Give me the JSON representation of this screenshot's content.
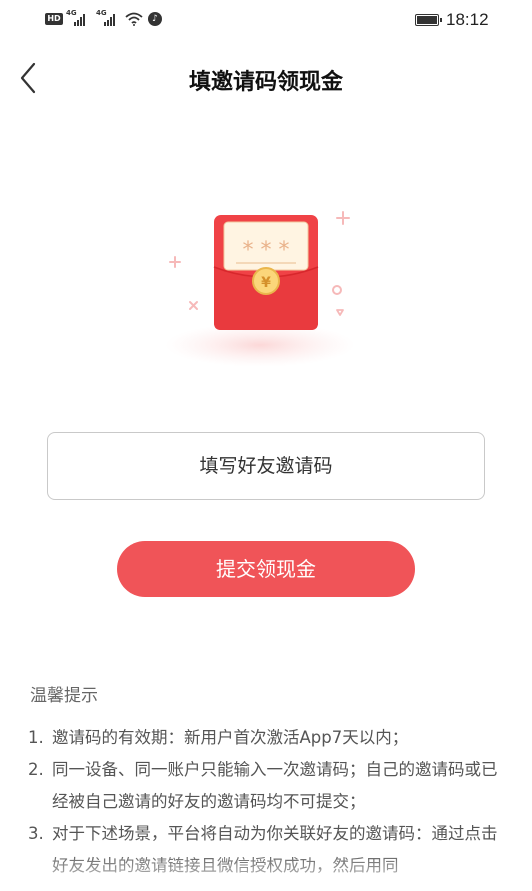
{
  "status_bar": {
    "hd_label": "HD",
    "network_1": "4G",
    "network_2": "4G",
    "time": "18:12",
    "icons": [
      "hd-icon",
      "signal-icon",
      "signal-icon",
      "wifi-icon",
      "tiktok-icon",
      "battery-icon"
    ]
  },
  "header": {
    "title": "填邀请码领现金",
    "back_icon": "chevron-left-icon"
  },
  "illustration": {
    "stars": "* * *",
    "coin_symbol": "¥",
    "accent_color": "#f04246"
  },
  "form": {
    "placeholder": "填写好友邀请码",
    "submit_label": "提交领现金"
  },
  "tips": {
    "title": "温馨提示",
    "items": [
      {
        "num": "1.",
        "text": "邀请码的有效期：新用户首次激活App7天以内；"
      },
      {
        "num": "2.",
        "text": "同一设备、同一账户只能输入一次邀请码；自己的邀请码或已经被自己邀请的好友的邀请码均不可提交；"
      },
      {
        "num": "3.",
        "text": "对于下述场景，平台将自动为你关联好友的邀请码：通过点击好友发出的邀请链接且微信授权成功，然后用同"
      }
    ]
  },
  "colors": {
    "primary_button": "#f05458",
    "envelope": "#f04246",
    "text_muted": "#555555"
  }
}
